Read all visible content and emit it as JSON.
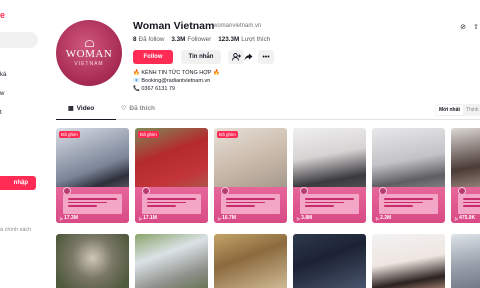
{
  "sidebar": {
    "items": [
      {
        "label": "ká"
      },
      {
        "label": "w"
      },
      {
        "label": "t"
      }
    ],
    "login_label": "nhập",
    "footer_label": "à chính sách"
  },
  "profile": {
    "name": "Woman Vietnam",
    "handle": "womanvietnam.vn",
    "avatar_logo": "WOMAN",
    "avatar_sub": "VIETNAM",
    "following_count": "8",
    "following_label": "Đã follow",
    "followers_count": "3.3M",
    "followers_label": "Follower",
    "likes_count": "123.3M",
    "likes_label": "Lượt thích",
    "follow_button": "Follow",
    "message_button": "Tin nhắn",
    "bio": [
      "🔥 KÊNH TIN TỨC TỔNG HỢP 🔥",
      "📧 Booking@radiantvietnam.vn",
      "📞 0367 6131 79"
    ]
  },
  "tabs": [
    {
      "label": "Video",
      "icon": "grid-icon"
    },
    {
      "label": "Đã thích",
      "icon": "heart-lock-icon"
    }
  ],
  "sort": {
    "options": [
      "Mới nhất",
      "Thịnh"
    ]
  },
  "videos": [
    {
      "pinned": "Đã ghim",
      "views": "17.3M"
    },
    {
      "pinned": "Đã ghim",
      "views": "17.1M"
    },
    {
      "pinned": "Đã ghim",
      "views": "16.7M"
    },
    {
      "pinned": "",
      "views": "3.8M"
    },
    {
      "pinned": "",
      "views": "2.2M"
    },
    {
      "pinned": "",
      "views": "475.9K"
    }
  ],
  "colors": {
    "accent": "#fe2c55",
    "pink_banner": "#e6679a",
    "avatar_bg": "#a52a52"
  }
}
